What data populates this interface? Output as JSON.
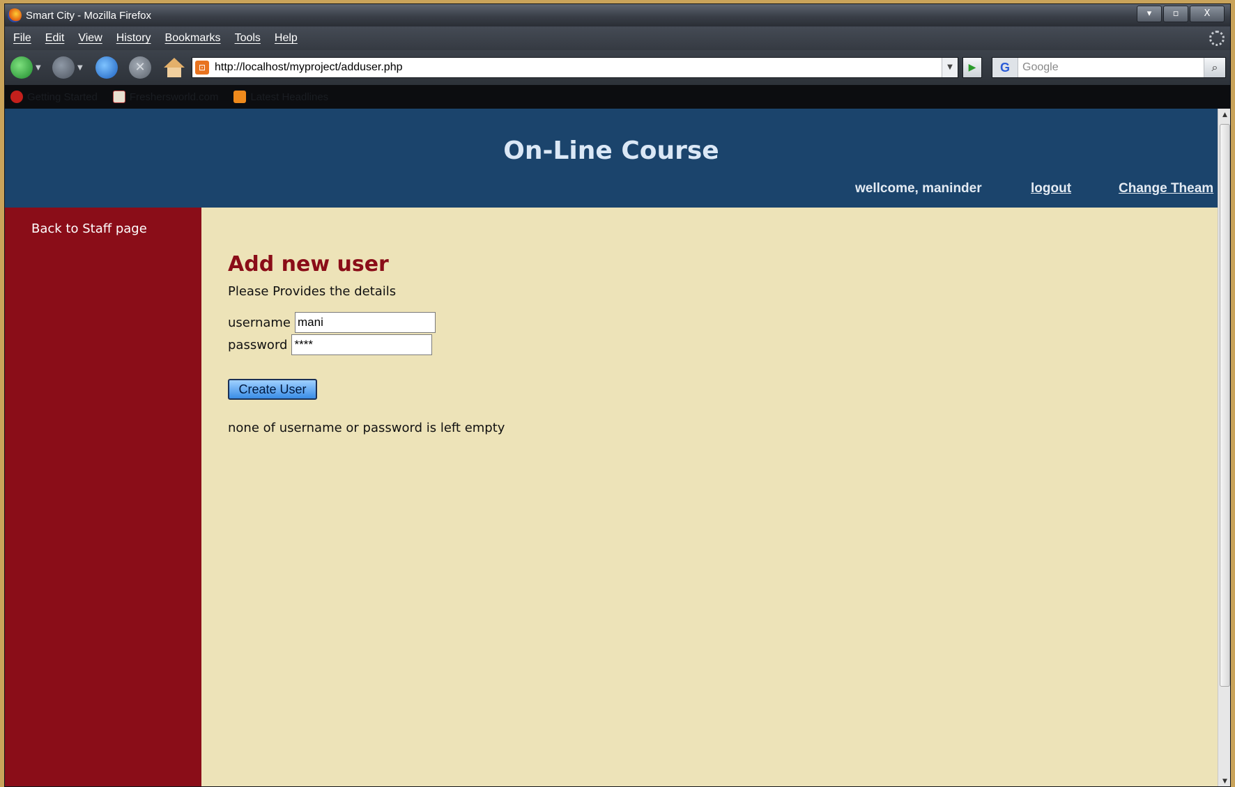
{
  "window": {
    "title": "Smart City - Mozilla Firefox",
    "controls": [
      "▾",
      "▫",
      "X"
    ]
  },
  "menu": [
    "File",
    "Edit",
    "View",
    "History",
    "Bookmarks",
    "Tools",
    "Help"
  ],
  "nav": {
    "url": "http://localhost/myproject/adduser.php",
    "search_placeholder": "Google"
  },
  "bookmarks": [
    "Getting Started",
    "Freshersworld.com",
    "Latest Headlines"
  ],
  "page": {
    "site_title": "On-Line Course",
    "welcome": "wellcome, maninder",
    "logout": "logout",
    "change_theme": "Change Theam",
    "sidebar_link": "Back to Staff page",
    "heading": "Add new user",
    "instructions": "Please Provides the details",
    "username_label": "username",
    "username_value": "mani",
    "password_label": "password",
    "password_value": "****",
    "create_button": "Create User",
    "message": "none of username or password is left empty"
  },
  "colors": {
    "header_bg": "#1b446c",
    "sidebar_bg": "#8a0d18",
    "content_bg": "#ede3b8",
    "heading_color": "#8a0d18"
  }
}
